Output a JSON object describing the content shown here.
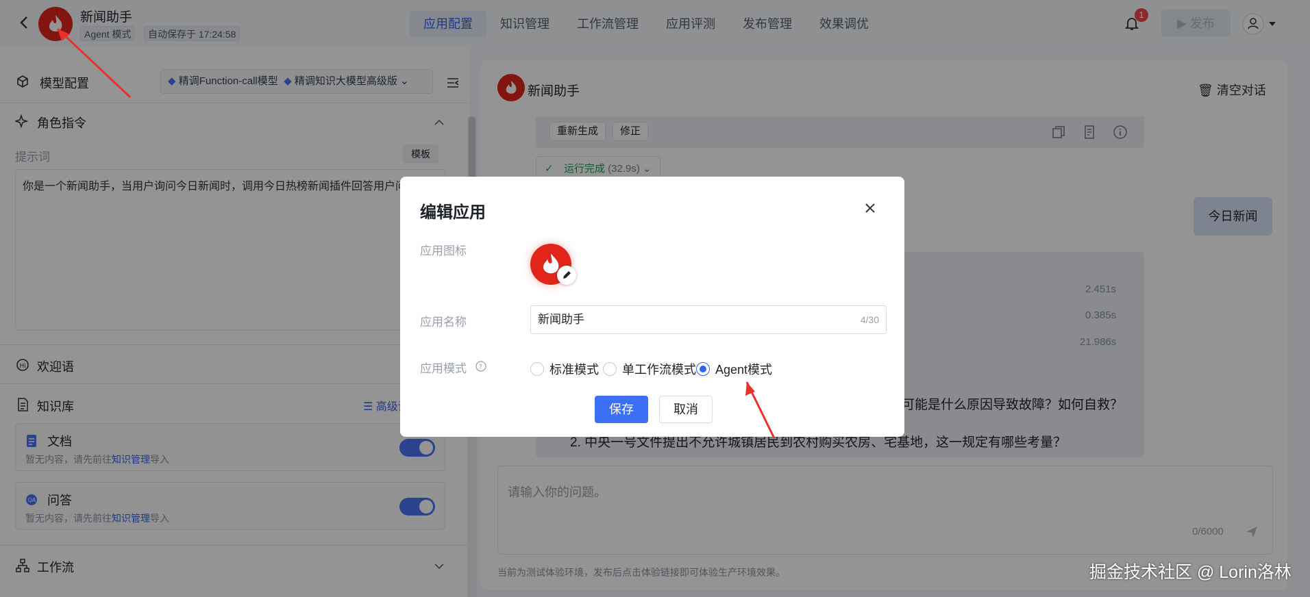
{
  "header": {
    "app_name": "新闻助手",
    "mode_tag": "Agent 模式",
    "autosave": "自动保存于 17:24:58",
    "nav": [
      "应用配置",
      "知识管理",
      "工作流管理",
      "应用评测",
      "发布管理",
      "效果调优"
    ],
    "notif_count": "1",
    "publish_label": "发布"
  },
  "left": {
    "model_config": "模型配置",
    "model_pill_1": "精调Function-call模型",
    "model_pill_2": "精调知识大模型高级版",
    "role_instr": "角色指令",
    "prompt_label": "提示词",
    "template_btn": "模板",
    "prompt_text": "你是一个新闻助手，当用户询问今日新闻时，调用今日热榜新闻插件回答用户问题",
    "welcome": "欢迎语",
    "kb": "知识库",
    "advanced": "高级设置",
    "doc": {
      "title": "文档",
      "desc_prefix": "暂无内容，请先前往",
      "desc_link": "知识管理",
      "desc_suffix": "导入"
    },
    "qa": {
      "title": "问答",
      "desc_prefix": "暂无内容，请先前往",
      "desc_link": "知识管理",
      "desc_suffix": "导入"
    },
    "workflow": "工作流"
  },
  "chat": {
    "name": "新闻助手",
    "clear": "清空对话",
    "regen": "重新生成",
    "fix": "修正",
    "run_status": "运行完成",
    "run_time": "(32.9s)",
    "user_msg": "今日新闻",
    "timings": [
      "2.451s",
      "0.385s",
      "21.986s"
    ],
    "line1": "可能是什么原因导致故障？如何自救？",
    "line2": "2. 中央一号文件提出不允许城镇居民到农村购买农房、宅基地，这一规定有哪些考量？",
    "placeholder": "请输入你的问题。",
    "counter": "0/6000",
    "footer": "当前为测试体验环境，发布后点击体验链接即可体验生产环境效果。",
    "watermark": "掘金技术社区 @ Lorin洛林"
  },
  "modal": {
    "title": "编辑应用",
    "icon_label": "应用图标",
    "name_label": "应用名称",
    "name_value": "新闻助手",
    "name_count": "4/30",
    "mode_label": "应用模式",
    "modes": [
      "标准模式",
      "单工作流模式",
      "Agent模式"
    ],
    "selected_mode": "Agent模式",
    "save": "保存",
    "cancel": "取消"
  },
  "colors": {
    "brand": "#e1251b",
    "primary": "#3b6ff5"
  }
}
